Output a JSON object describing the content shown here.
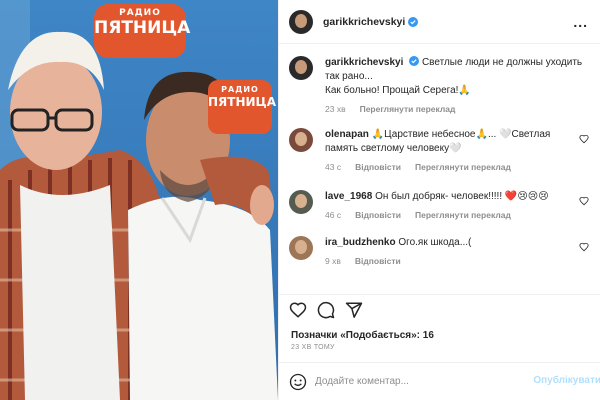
{
  "photo": {
    "sign_main": {
      "small": "РАДИО",
      "big": "ПЯТНИЦА"
    },
    "sign_side": {
      "small": "РАДИО",
      "big": "ПЯТНИЦА"
    }
  },
  "header": {
    "username": "garikkrichevskyi",
    "more": "..."
  },
  "caption": {
    "username": "garikkrichevskyi",
    "text": "Светлые люди не должны уходить так рано...",
    "text2": "Как больно! Прощай Серега!🙏",
    "time": "23 хв",
    "translate": "Переглянути переклад"
  },
  "comments": [
    {
      "username": "olenapan",
      "text": "🙏Царствие небесное🙏... 🤍Светлая память светлому человеку🤍",
      "time": "43 с",
      "reply": "Відповісти",
      "translate": "Переглянути переклад"
    },
    {
      "username": "lave_1968",
      "text": "Он был добряк- человек!!!!! ❤️😢😢😢",
      "time": "46 с",
      "reply": "Відповісти",
      "translate": "Переглянути переклад"
    },
    {
      "username": "ira_budzhenko",
      "text": "Ого.як шкода...(",
      "time": "9 хв",
      "reply": "Відповісти"
    }
  ],
  "likes": {
    "label": "Позначки «Подобається»: 16"
  },
  "timestamp": "23 ХВ ТОМУ",
  "add_comment": {
    "placeholder": "Додайте коментар...",
    "publish": "Опублікувати"
  },
  "colors": {
    "link_blue": "#b2dffc",
    "verified": "#3897f0",
    "sign": "#e2562e",
    "muted": "#8e8e8e"
  }
}
